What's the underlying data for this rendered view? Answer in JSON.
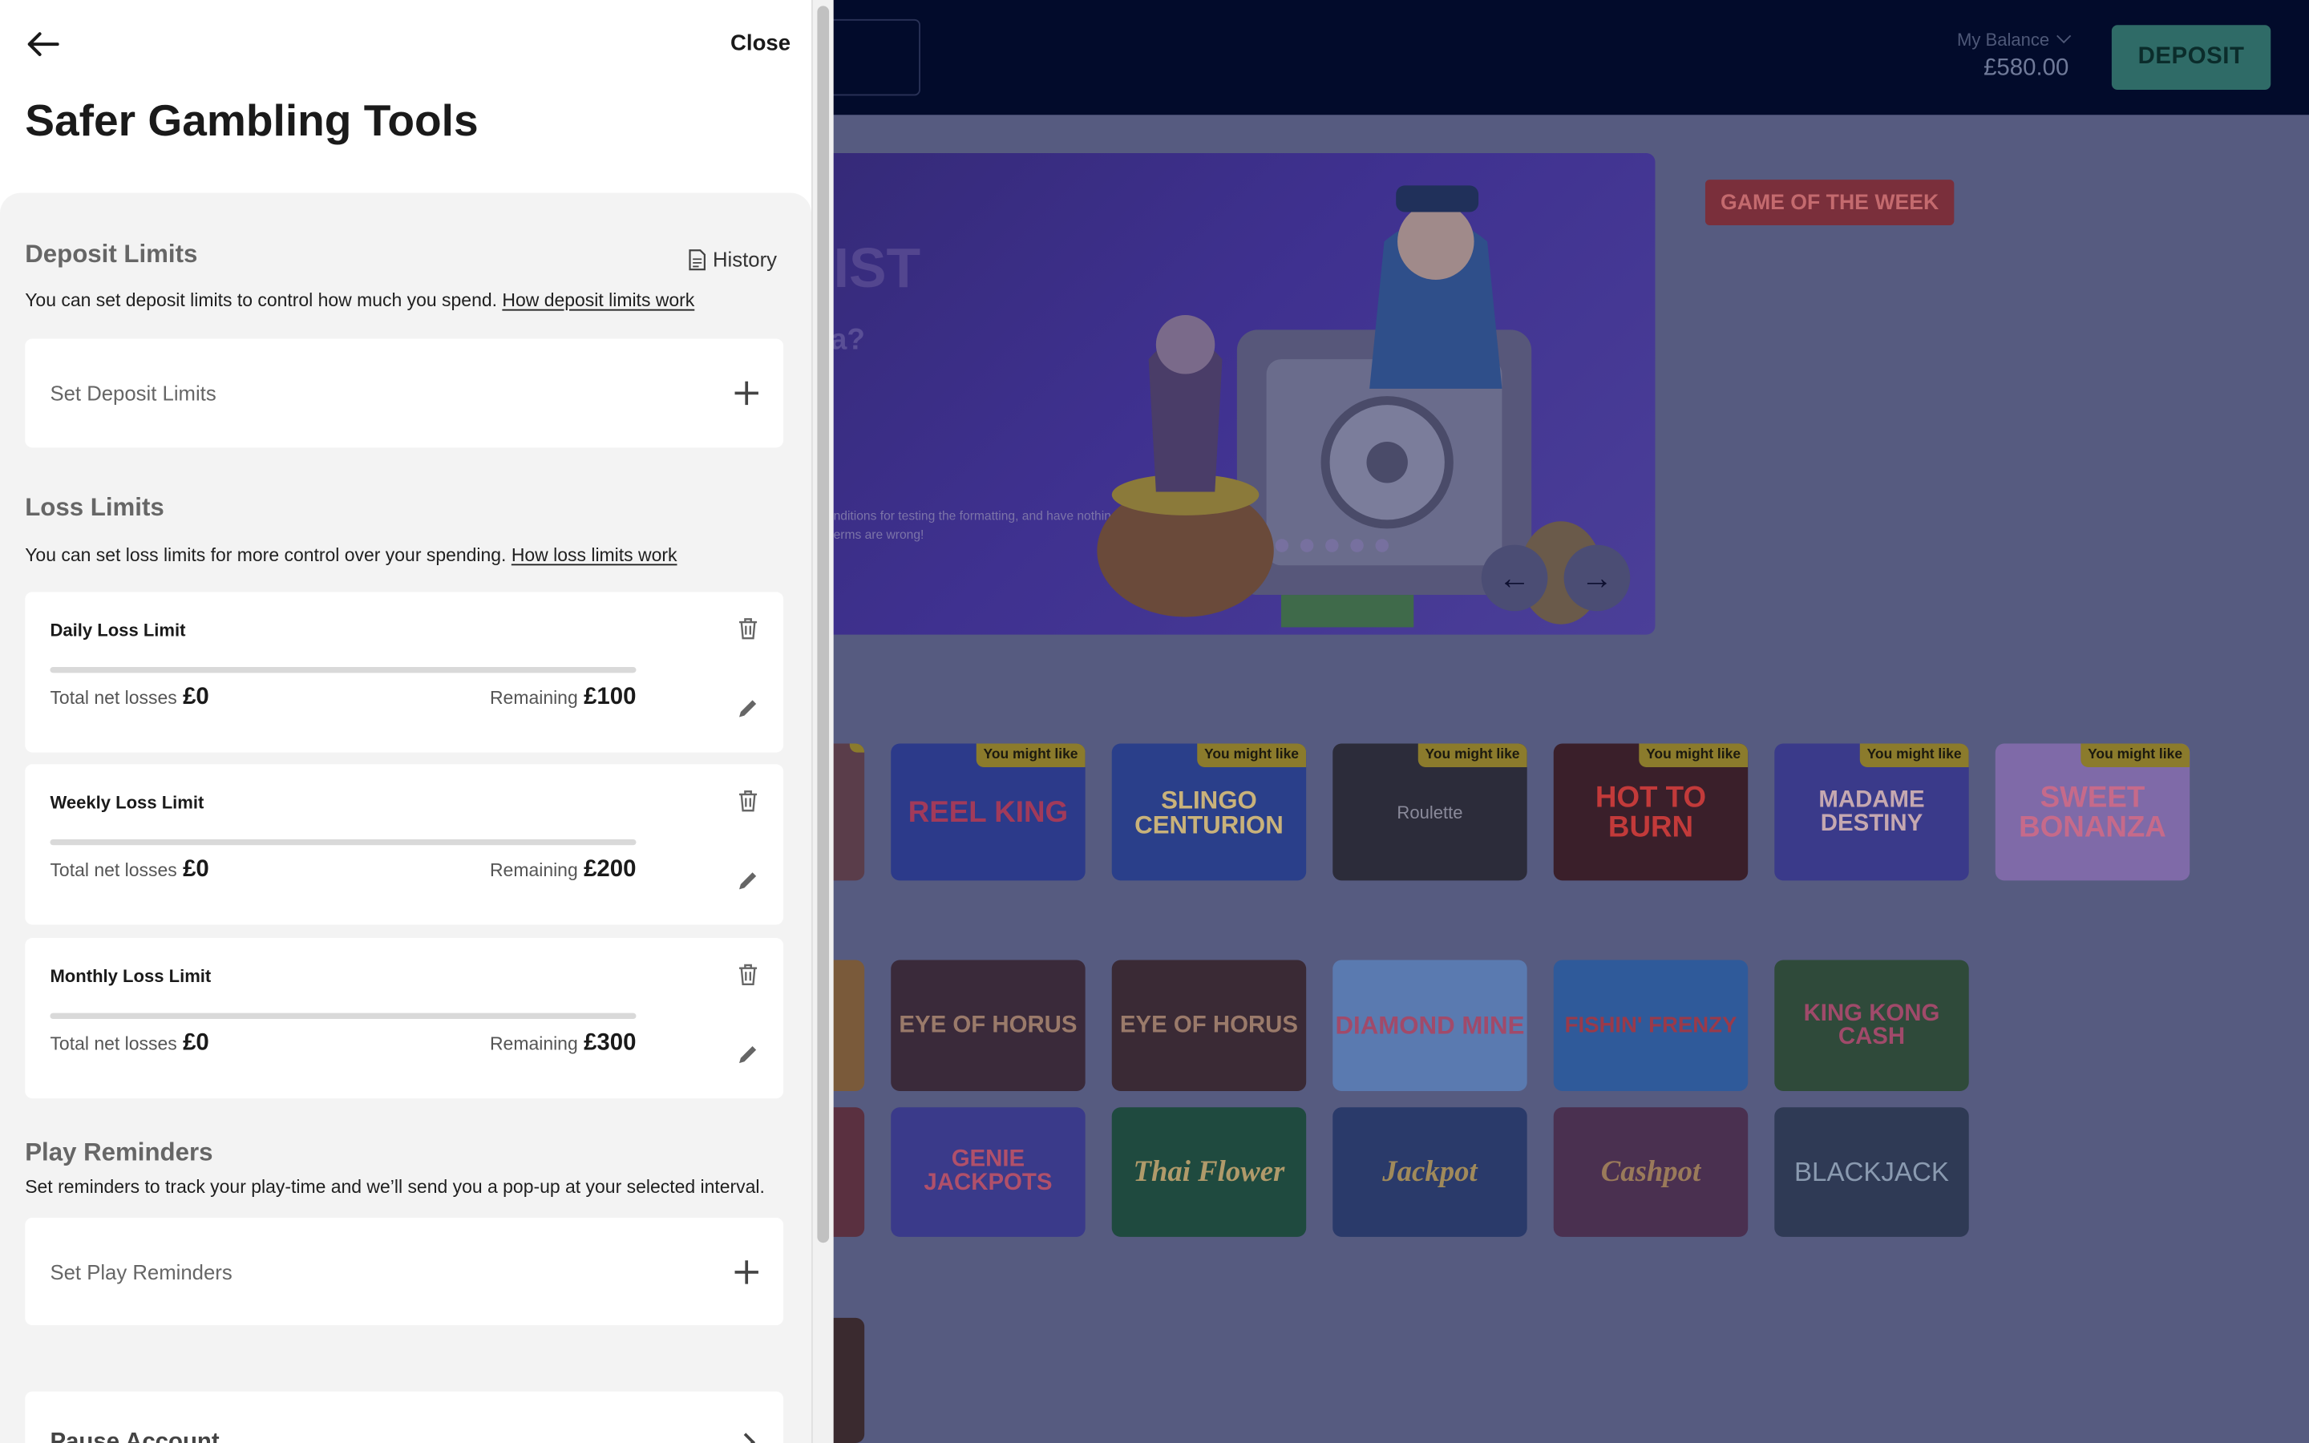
{
  "background": {
    "header": {
      "balance_label": "My Balance",
      "balance_value": "£580.00",
      "deposit_label": "DEPOSIT"
    },
    "hero": {
      "title_fragment": "IST",
      "question_fragment": "a?",
      "terms_line1": "nditions for testing the formatting, and have nothing to do",
      "terms_line2": "erms are wrong!",
      "dot_count": 5
    },
    "game_of_week_label": "GAME OF THE WEEK",
    "recommend_badge": "You might like",
    "row1_games": [
      "",
      "REEL KING",
      "SLINGO CENTURION",
      "Roulette",
      "HOT TO BURN",
      "MADAME DESTINY",
      "SWEET BONANZA"
    ],
    "row2_games": [
      "",
      "EYE OF HORUS",
      "EYE OF HORUS",
      "DIAMOND MINE",
      "FISHIN' FRENZY",
      "KING KONG CASH"
    ],
    "row3_games": [
      "",
      "GENIE JACKPOTS",
      "Thai Flower",
      "Jackpot",
      "Cashpot",
      "BLACKJACK"
    ]
  },
  "drawer": {
    "close_label": "Close",
    "title": "Safer Gambling Tools",
    "deposit_limits": {
      "heading": "Deposit Limits",
      "history_label": "History",
      "description": "You can set deposit limits to control how much you spend.",
      "link": "How deposit limits work",
      "set_label": "Set Deposit Limits"
    },
    "loss_limits": {
      "heading": "Loss Limits",
      "description": "You can set loss limits for more control over your spending.",
      "link": "How loss limits work",
      "items": [
        {
          "name": "Daily Loss Limit",
          "net_label": "Total net losses",
          "net_value": "£0",
          "remaining_label": "Remaining",
          "remaining_value": "£100",
          "progress": 0
        },
        {
          "name": "Weekly Loss Limit",
          "net_label": "Total net losses",
          "net_value": "£0",
          "remaining_label": "Remaining",
          "remaining_value": "£200",
          "progress": 0
        },
        {
          "name": "Monthly Loss Limit",
          "net_label": "Total net losses",
          "net_value": "£0",
          "remaining_label": "Remaining",
          "remaining_value": "£300",
          "progress": 0
        }
      ]
    },
    "play_reminders": {
      "heading": "Play Reminders",
      "description": "Set reminders to track your play-time and we’ll send you a pop-up at your selected interval.",
      "set_label": "Set Play Reminders"
    },
    "pause_account": {
      "label": "Pause Account"
    }
  }
}
